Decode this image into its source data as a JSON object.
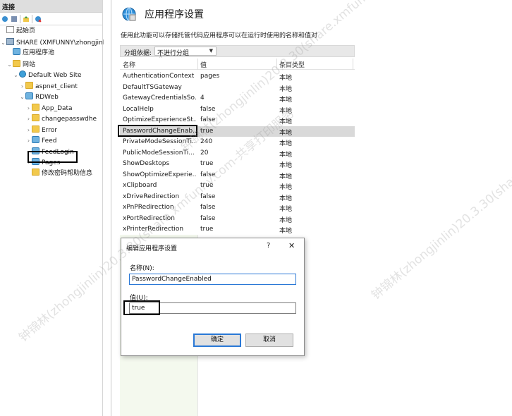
{
  "left_panel": {
    "header": "连接",
    "tree": [
      {
        "label": "起始页",
        "icon": "start-page-icon",
        "indent": 0,
        "expander": ""
      },
      {
        "label": "SHARE (XMFUNNY\\zhongjinlin",
        "icon": "server-icon",
        "indent": 0,
        "expander": "⌄"
      },
      {
        "label": "应用程序池",
        "icon": "app-pool-icon",
        "indent": 1,
        "expander": ""
      },
      {
        "label": "网站",
        "icon": "sites-folder-icon",
        "indent": 1,
        "expander": "⌄"
      },
      {
        "label": "Default Web Site",
        "icon": "globe-icon",
        "indent": 2,
        "expander": "⌄"
      },
      {
        "label": "aspnet_client",
        "icon": "folder-icon",
        "indent": 3,
        "expander": "›"
      },
      {
        "label": "RDWeb",
        "icon": "web-app-icon",
        "indent": 3,
        "expander": "⌄"
      },
      {
        "label": "App_Data",
        "icon": "folder-icon",
        "indent": 4,
        "expander": "›"
      },
      {
        "label": "changepasswdhe",
        "icon": "folder-icon",
        "indent": 4,
        "expander": "›"
      },
      {
        "label": "Error",
        "icon": "folder-icon",
        "indent": 4,
        "expander": "›"
      },
      {
        "label": "Feed",
        "icon": "web-app-icon",
        "indent": 4,
        "expander": "›"
      },
      {
        "label": "FeedLogin",
        "icon": "web-app-icon",
        "indent": 4,
        "expander": "›"
      },
      {
        "label": "Pages",
        "icon": "web-app-icon",
        "indent": 4,
        "expander": "›"
      },
      {
        "label": "修改密码帮助信息",
        "icon": "folder-icon",
        "indent": 4,
        "expander": ""
      }
    ]
  },
  "main": {
    "title": "应用程序设置",
    "description": "使用此功能可以存储托管代码应用程序可以在运行时使用的名称和值对",
    "group_by_label": "分组依据:",
    "group_by_value": "不进行分组",
    "columns": {
      "name": "名称",
      "value": "值",
      "entry_type": "条目类型"
    },
    "rows": [
      {
        "name": "AuthenticationContext",
        "value": "pages",
        "type": "本地"
      },
      {
        "name": "DefaultTSGateway",
        "value": "",
        "type": "本地"
      },
      {
        "name": "GatewayCredentialsSo...",
        "value": "4",
        "type": "本地"
      },
      {
        "name": "LocalHelp",
        "value": "false",
        "type": "本地"
      },
      {
        "name": "OptimizeExperienceSt...",
        "value": "false",
        "type": "本地"
      },
      {
        "name": "PasswordChangeEnab...",
        "value": "true",
        "type": "本地"
      },
      {
        "name": "PrivateModeSessionTi...",
        "value": "240",
        "type": "本地"
      },
      {
        "name": "PublicModeSessionTi...",
        "value": "20",
        "type": "本地"
      },
      {
        "name": "ShowDesktops",
        "value": "true",
        "type": "本地"
      },
      {
        "name": "ShowOptimizeExperie...",
        "value": "false",
        "type": "本地"
      },
      {
        "name": "xClipboard",
        "value": "true",
        "type": "本地"
      },
      {
        "name": "xDriveRedirection",
        "value": "false",
        "type": "本地"
      },
      {
        "name": "xPnPRedirection",
        "value": "false",
        "type": "本地"
      },
      {
        "name": "xPortRedirection",
        "value": "false",
        "type": "本地"
      },
      {
        "name": "xPrinterRedirection",
        "value": "true",
        "type": "本地"
      }
    ],
    "selected_row": 5
  },
  "dialog": {
    "title": "编辑应用程序设置",
    "help": "?",
    "close": "✕",
    "name_label": "名称(N):",
    "name_value": "PasswordChangeEnabled",
    "value_label": "值(U):",
    "value_value": "true",
    "ok": "确定",
    "cancel": "取消"
  },
  "watermark": "钟锦林(zhongjinlin)20.3.30(share.xmfunny.com-共享打印服务"
}
